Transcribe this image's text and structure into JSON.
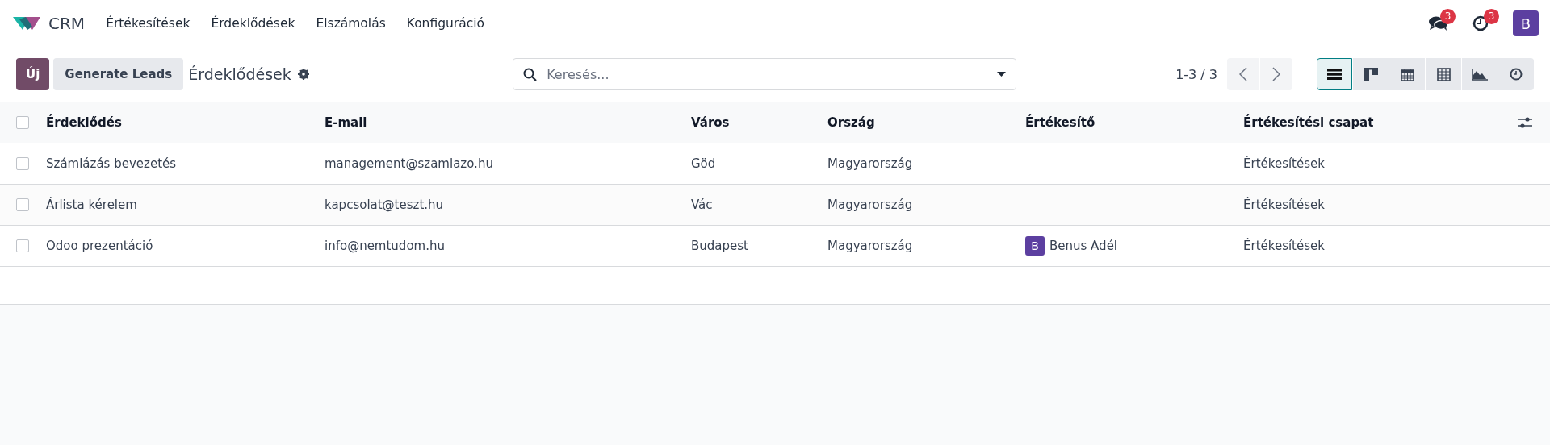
{
  "navbar": {
    "app": "CRM",
    "menu": [
      "Értékesítések",
      "Érdeklődések",
      "Elszámolás",
      "Konfiguráció"
    ],
    "messages_badge": "3",
    "activities_badge": "3",
    "user_initial": "B"
  },
  "control_panel": {
    "new_button": "Új",
    "generate_button": "Generate Leads",
    "title": "Érdeklődések",
    "search": {
      "placeholder": "Keresés..."
    },
    "pager": "1-3 / 3",
    "views": [
      {
        "kind": "list",
        "selected": true
      },
      {
        "kind": "kanban",
        "selected": false
      },
      {
        "kind": "calendar",
        "selected": false
      },
      {
        "kind": "pivot",
        "selected": false
      },
      {
        "kind": "graph",
        "selected": false
      },
      {
        "kind": "activity",
        "selected": false
      }
    ]
  },
  "table": {
    "select_all_checked": false,
    "columns": [
      "Érdeklődés",
      "E-mail",
      "Város",
      "Ország",
      "Értékesítő",
      "Értékesítési csapat"
    ],
    "rows": [
      {
        "checked": false,
        "cells": [
          "Számlázás bevezetés",
          "management@szamlazo.hu",
          "Göd",
          "Magyarország",
          null,
          "Értékesítések"
        ]
      },
      {
        "checked": false,
        "cells": [
          "Árlista kérelem",
          "kapcsolat@teszt.hu",
          "Vác",
          "Magyarország",
          null,
          "Értékesítések"
        ]
      },
      {
        "checked": false,
        "cells": [
          "Odoo prezentáció",
          "info@nemtudom.hu",
          "Budapest",
          "Magyarország",
          {
            "initial": "B",
            "name": "Benus Adél"
          },
          "Értékesítések"
        ]
      }
    ]
  }
}
